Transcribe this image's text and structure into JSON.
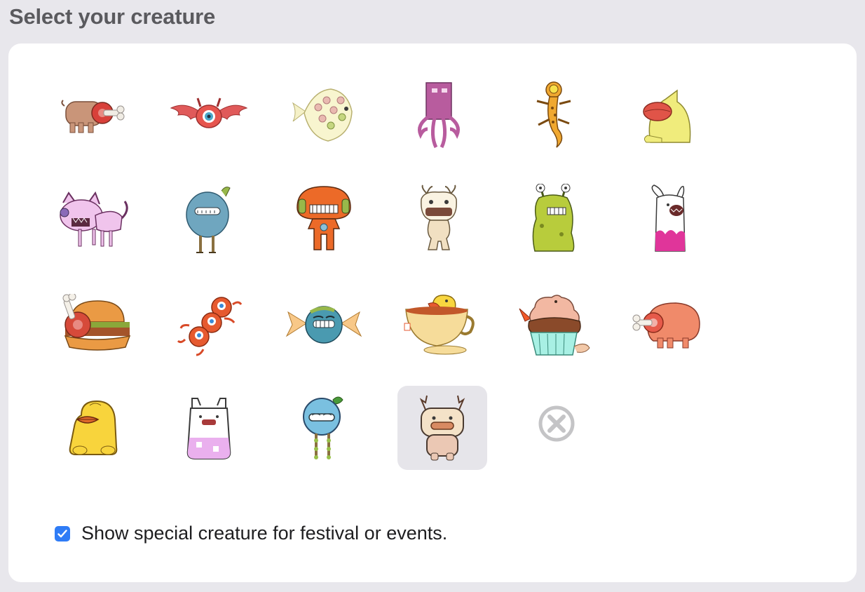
{
  "header": {
    "title": "Select your creature"
  },
  "creatures": [
    {
      "name": "meat-pig"
    },
    {
      "name": "winged-eyeball"
    },
    {
      "name": "spotted-fish"
    },
    {
      "name": "pink-octopus"
    },
    {
      "name": "orange-gecko"
    },
    {
      "name": "yellow-duck-blob"
    },
    {
      "name": "pink-cat"
    },
    {
      "name": "blue-bird-legs"
    },
    {
      "name": "orange-mushroom"
    },
    {
      "name": "antlered-doll"
    },
    {
      "name": "green-slug"
    },
    {
      "name": "pink-rabbit-drip"
    },
    {
      "name": "hamburger"
    },
    {
      "name": "red-eye-cluster"
    },
    {
      "name": "wrapped-candy"
    },
    {
      "name": "teacup-duck"
    },
    {
      "name": "cupcake"
    },
    {
      "name": "ham-pig"
    },
    {
      "name": "pixel-yellow-duck"
    },
    {
      "name": "pixel-pink-rabbit"
    },
    {
      "name": "pixel-blue-bird"
    },
    {
      "name": "pixel-antler-creature",
      "selected": true
    },
    {
      "name": "none"
    }
  ],
  "options": {
    "special_creature_label": "Show special creature for festival or events.",
    "special_creature_checked": true
  },
  "colors": {
    "accent": "#2f7cf6",
    "selection": "#e6e5ea",
    "background": "#e8e7ec"
  },
  "icons": {
    "none": "x-circle-icon",
    "check": "checkmark-icon"
  }
}
